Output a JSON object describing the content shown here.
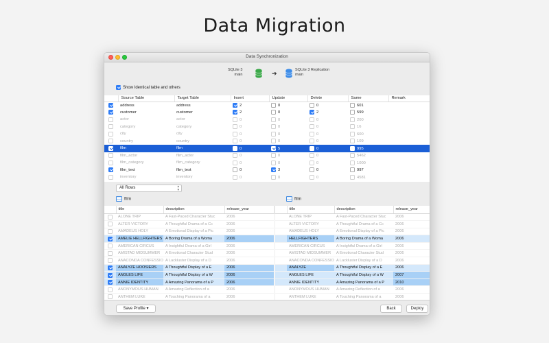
{
  "headline": "Data Migration",
  "window": {
    "title": "Data Synchronization"
  },
  "source": {
    "line1": "SQLite 3",
    "line2": "main"
  },
  "target": {
    "line1": "SQLite 3 Replication",
    "line2": "main"
  },
  "show_identical": {
    "label": "Show Identical table and others",
    "checked": true
  },
  "table_headers": [
    "Source Table",
    "Target Table",
    "Insert",
    "Update",
    "Delete",
    "Same",
    "Remark"
  ],
  "tables": [
    {
      "checked": true,
      "source": "address",
      "target": "address",
      "insert": {
        "checked": true,
        "value": "2"
      },
      "update": {
        "checked": false,
        "value": "0"
      },
      "delete": {
        "checked": false,
        "value": "0"
      },
      "same": {
        "checked": false,
        "value": "601"
      },
      "state": "normal"
    },
    {
      "checked": true,
      "source": "customer",
      "target": "customer",
      "insert": {
        "checked": true,
        "value": "2"
      },
      "update": {
        "checked": false,
        "value": "0"
      },
      "delete": {
        "checked": true,
        "value": "2"
      },
      "same": {
        "checked": false,
        "value": "599"
      },
      "state": "normal"
    },
    {
      "checked": false,
      "source": "actor",
      "target": "actor",
      "insert": {
        "checked": false,
        "value": "0"
      },
      "update": {
        "checked": false,
        "value": "0"
      },
      "delete": {
        "checked": false,
        "value": "0"
      },
      "same": {
        "checked": false,
        "value": "200"
      },
      "state": "dim"
    },
    {
      "checked": false,
      "source": "category",
      "target": "category",
      "insert": {
        "checked": false,
        "value": "0"
      },
      "update": {
        "checked": false,
        "value": "0"
      },
      "delete": {
        "checked": false,
        "value": "0"
      },
      "same": {
        "checked": false,
        "value": "16"
      },
      "state": "dim"
    },
    {
      "checked": false,
      "source": "city",
      "target": "city",
      "insert": {
        "checked": false,
        "value": "0"
      },
      "update": {
        "checked": false,
        "value": "0"
      },
      "delete": {
        "checked": false,
        "value": "0"
      },
      "same": {
        "checked": false,
        "value": "600"
      },
      "state": "dim"
    },
    {
      "checked": false,
      "source": "country",
      "target": "country",
      "insert": {
        "checked": false,
        "value": "0"
      },
      "update": {
        "checked": false,
        "value": "0"
      },
      "delete": {
        "checked": false,
        "value": "0"
      },
      "same": {
        "checked": false,
        "value": "109"
      },
      "state": "dim"
    },
    {
      "checked": true,
      "source": "film",
      "target": "film",
      "insert": {
        "checked": false,
        "value": "0"
      },
      "update": {
        "checked": true,
        "value": "5"
      },
      "delete": {
        "checked": false,
        "value": "0"
      },
      "same": {
        "checked": false,
        "value": "995"
      },
      "state": "selected"
    },
    {
      "checked": false,
      "source": "film_actor",
      "target": "film_actor",
      "insert": {
        "checked": false,
        "value": "0"
      },
      "update": {
        "checked": false,
        "value": "0"
      },
      "delete": {
        "checked": false,
        "value": "0"
      },
      "same": {
        "checked": false,
        "value": "5462"
      },
      "state": "dim"
    },
    {
      "checked": false,
      "source": "film_category",
      "target": "film_category",
      "insert": {
        "checked": false,
        "value": "0"
      },
      "update": {
        "checked": false,
        "value": "0"
      },
      "delete": {
        "checked": false,
        "value": "0"
      },
      "same": {
        "checked": false,
        "value": "1000"
      },
      "state": "dim"
    },
    {
      "checked": true,
      "source": "film_text",
      "target": "film_text",
      "insert": {
        "checked": false,
        "value": "0"
      },
      "update": {
        "checked": true,
        "value": "3"
      },
      "delete": {
        "checked": false,
        "value": "0"
      },
      "same": {
        "checked": false,
        "value": "997"
      },
      "state": "normal"
    },
    {
      "checked": false,
      "source": "inventory",
      "target": "inventory",
      "insert": {
        "checked": false,
        "value": "0"
      },
      "update": {
        "checked": false,
        "value": "0"
      },
      "delete": {
        "checked": false,
        "value": "0"
      },
      "same": {
        "checked": false,
        "value": "4581"
      },
      "state": "dim"
    }
  ],
  "rows_filter": "All Rows",
  "left_table": {
    "name": "film",
    "headers": [
      "title",
      "description",
      "release_year"
    ],
    "rows": [
      {
        "checked": false,
        "title": "ALONE TRIP",
        "description": "A Fast-Paced Character Stuc",
        "year": "2006",
        "state": "dim"
      },
      {
        "checked": false,
        "title": "ALTER VICTORY",
        "description": "A Thoughtful Drama of a Cc",
        "year": "2006",
        "state": "dim"
      },
      {
        "checked": false,
        "title": "AMADEUS HOLY",
        "description": "A Emotional Display of a Pic",
        "year": "2006",
        "state": "dim"
      },
      {
        "checked": true,
        "title": "AMELIE HELLFIGHTERS",
        "description": "A Boring Drama of a Woma",
        "year": "2006",
        "state": "hl"
      },
      {
        "checked": false,
        "title": "AMERICAN CIRCUS",
        "description": "A Insightful Drama of a Girl",
        "year": "2006",
        "state": "dim"
      },
      {
        "checked": false,
        "title": "AMISTAD MIDSUMMER",
        "description": "A Emotional Character Stud",
        "year": "2006",
        "state": "dim"
      },
      {
        "checked": false,
        "title": "ANACONDA CONFESSIO",
        "description": "A Lackluster Display of a D",
        "year": "2006",
        "state": "dim"
      },
      {
        "checked": true,
        "title": "ANALYZE HOOSIERS",
        "description": "A Thoughtful Display of a E",
        "year": "2006",
        "state": "hl"
      },
      {
        "checked": true,
        "title": "ANGLES LIFE",
        "description": "A Thoughtful Display of a W",
        "year": "2006",
        "state": "hl"
      },
      {
        "checked": true,
        "title": "ANNIE IDENTITY",
        "description": "A Amazing Panorama of a P",
        "year": "2006",
        "state": "hl"
      },
      {
        "checked": false,
        "title": "ANONYMOUS HUMAN",
        "description": "A Amazing Reflection of a",
        "year": "2006",
        "state": "dim"
      },
      {
        "checked": false,
        "title": "ANTHEM LUKE",
        "description": "A Touching Panorama of a",
        "year": "2006",
        "state": "dim"
      }
    ]
  },
  "right_table": {
    "name": "film",
    "headers": [
      "title",
      "description",
      "release_year"
    ],
    "rows": [
      {
        "title": "ALONE TRIP",
        "description": "A Fast-Paced Character Stuc",
        "year": "2006",
        "state": "dim"
      },
      {
        "title": "ALTER VICTORY",
        "description": "A Thoughtful Drama of a Cc",
        "year": "2006",
        "state": "dim"
      },
      {
        "title": "AMADEUS HOLY",
        "description": "A Emotional Display of a Pic",
        "year": "2006",
        "state": "dim"
      },
      {
        "title": "HELLFIGHTERS",
        "description": "A Boring Drama of a Woma",
        "year": "2006",
        "state": "hl"
      },
      {
        "title": "AMERICAN CIRCUS",
        "description": "A Insightful Drama of a Girl",
        "year": "2006",
        "state": "dim"
      },
      {
        "title": "AMISTAD MIDSUMMER",
        "description": "A Emotional Character Stud",
        "year": "2006",
        "state": "dim"
      },
      {
        "title": "ANACONDA CONFESSIO",
        "description": "A Lackluster Display of a D",
        "year": "2006",
        "state": "dim"
      },
      {
        "title": "ANALYZE",
        "description": "A Thoughtful Display of a E",
        "year": "2006",
        "state": "hl"
      },
      {
        "title": "ANGLES LIFE",
        "description": "A Thoughtful Display of a W",
        "year": "2007",
        "state": "hl"
      },
      {
        "title": "ANNIE IDENTITY",
        "description": "A Amazing Panorama of a P",
        "year": "2010",
        "state": "hl"
      },
      {
        "title": "ANONYMOUS HUMAN",
        "description": "A Amazing Reflection of a",
        "year": "2006",
        "state": "dim"
      },
      {
        "title": "ANTHEM LUKE",
        "description": "A Touching Panorama of a",
        "year": "2006",
        "state": "dim"
      }
    ],
    "changed_cells": [
      [
        3,
        "title"
      ],
      [
        7,
        "title"
      ],
      [
        8,
        "year"
      ],
      [
        9,
        "year"
      ]
    ]
  },
  "buttons": {
    "save_profile": "Save Profile ▾",
    "back": "Back",
    "deploy": "Deploy"
  },
  "colors": {
    "accent": "#2e7cf6",
    "selection": "#1b5fd6",
    "diff_row": "#d4e8fb",
    "diff_cell": "#a8d0f6",
    "source_db": "#3aa848",
    "target_db": "#3e8de8"
  },
  "icons": {
    "source_db": "database-icon",
    "target_db": "database-icon",
    "arrow": "arrow-right-icon",
    "table": "table-icon"
  }
}
